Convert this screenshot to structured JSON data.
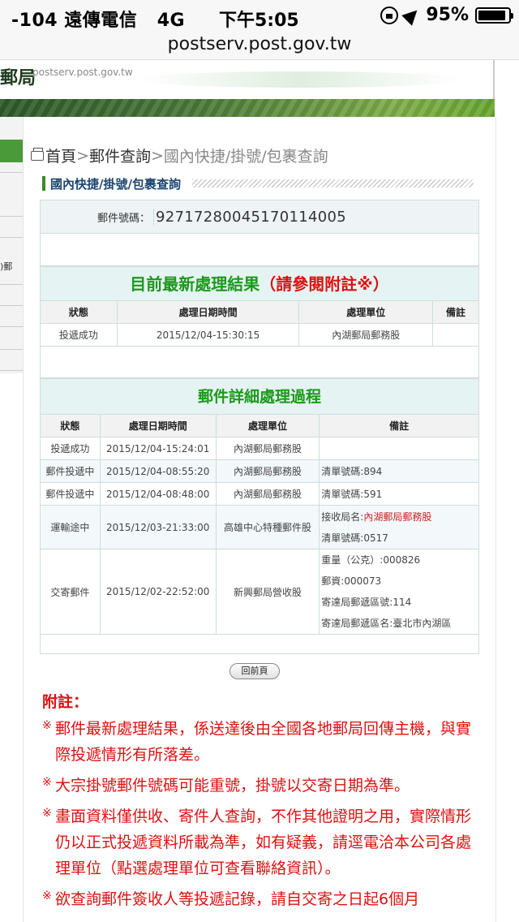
{
  "status_bar": {
    "carrier": "-104 遠傳電信",
    "network": "4G",
    "time": "下午5:05",
    "battery": "95%"
  },
  "browser": {
    "url": "postserv.post.gov.tw"
  },
  "site": {
    "logo": "郵局",
    "logo_url": "postserv.post.gov.tw"
  },
  "left_strip": {
    "fragment": ")郵"
  },
  "breadcrumb": {
    "home": "首頁",
    "sep1": ">",
    "item1": "郵件查詢",
    "sep2": ">",
    "current": "國內快捷/掛號/包裹查詢"
  },
  "section_title": "國內快捷/掛號/包裹查詢",
  "tracking": {
    "label": "郵件號碼：",
    "number": "92717280045170114005"
  },
  "latest": {
    "title": "目前最新處理結果",
    "title_note": "（請參閱附註※）",
    "headers": [
      "狀態",
      "處理日期時間",
      "處理單位",
      "備註"
    ],
    "row": {
      "status": "投遞成功",
      "datetime": "2015/12/04-15:30:15",
      "unit": "內湖郵局郵務股",
      "note": ""
    }
  },
  "detail": {
    "title": "郵件詳細處理過程",
    "headers": [
      "狀態",
      "處理日期時間",
      "處理單位",
      "備註"
    ],
    "rows": [
      {
        "status": "投遞成功",
        "datetime": "2015/12/04-15:24:01",
        "unit": "內湖郵局郵務股",
        "note_lines": []
      },
      {
        "status": "郵件投遞中",
        "datetime": "2015/12/04-08:55:20",
        "unit": "內湖郵局郵務股",
        "note_lines": [
          "清單號碼:894"
        ]
      },
      {
        "status": "郵件投遞中",
        "datetime": "2015/12/04-08:48:00",
        "unit": "內湖郵局郵務股",
        "note_lines": [
          "清單號碼:591"
        ]
      },
      {
        "status": "運輸途中",
        "datetime": "2015/12/03-21:33:00",
        "unit": "高雄中心特種郵件股",
        "note_prefix": "接收局名:",
        "note_unit": "內湖郵局郵務股",
        "note_lines": [
          "清單號碼:0517"
        ]
      },
      {
        "status": "交寄郵件",
        "datetime": "2015/12/02-22:52:00",
        "unit": "新興郵局營收股",
        "note_lines": [
          "重量（公克）:000826",
          "郵資:000073",
          "寄達局郵遞區號:114",
          "寄達局郵遞區名:臺北市內湖區"
        ]
      }
    ]
  },
  "back_button": "回前頁",
  "notes": {
    "title": "附註：",
    "marker": "※",
    "items": [
      "郵件最新處理結果，係送達後由全國各地郵局回傳主機，與實際投遞情形有所落差。",
      "大宗掛號郵件號碼可能重號，掛號以交寄日期為準。",
      "畫面資料僅供收、寄件人查詢，不作其他證明之用，實際情形仍以正式投遞資料所載為準，如有疑義，請逕電洽本公司各處理單位（點選處理單位可查看聯絡資訊）。",
      "欲查詢郵件簽收人等投遞記錄，請自交寄之日起6個月"
    ]
  }
}
